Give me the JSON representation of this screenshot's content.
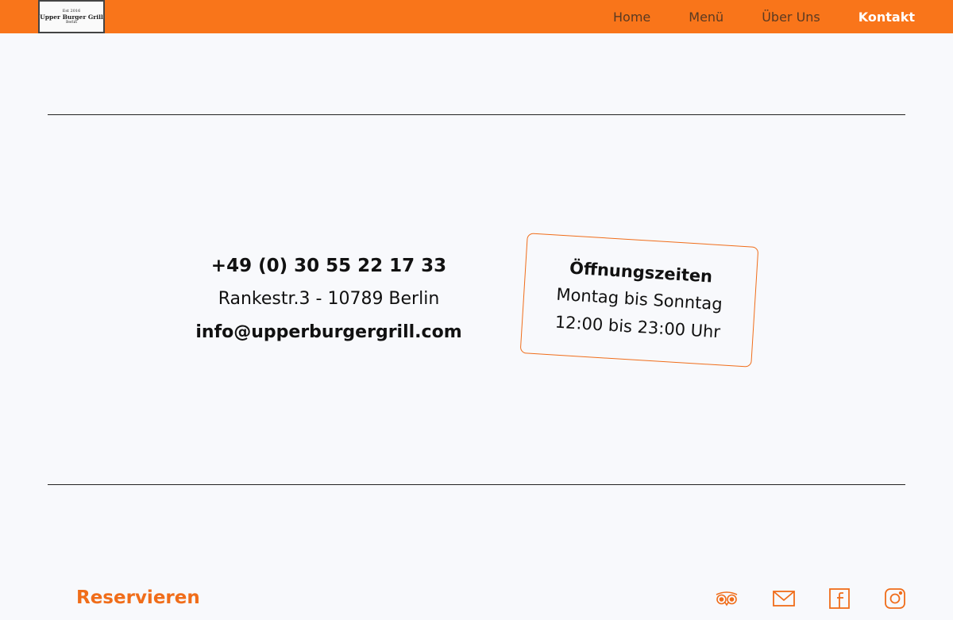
{
  "brand": {
    "logo_est": "Est 2016",
    "logo_name": "Upper Burger Grill",
    "logo_city": "Berlin"
  },
  "nav": {
    "items": [
      {
        "label": "Home"
      },
      {
        "label": "Menü"
      },
      {
        "label": "Über Uns"
      },
      {
        "label": "Kontakt"
      }
    ],
    "active": "Kontakt"
  },
  "contact": {
    "phone": "+49 (0) 30 55 22 17 33",
    "address": "Rankestr.3 - 10789 Berlin",
    "email": "info@upperburgergrill.com"
  },
  "hours": {
    "title": "Öffnungszeiten",
    "days": "Montag bis Sonntag",
    "time": "12:00 bis 23:00 Uhr"
  },
  "footer": {
    "reserve_label": "Reservieren",
    "social_icons": [
      "tripadvisor-icon",
      "mail-icon",
      "facebook-icon",
      "instagram-icon"
    ]
  },
  "colors": {
    "accent": "#f9751a",
    "background": "#f8f9fc"
  }
}
